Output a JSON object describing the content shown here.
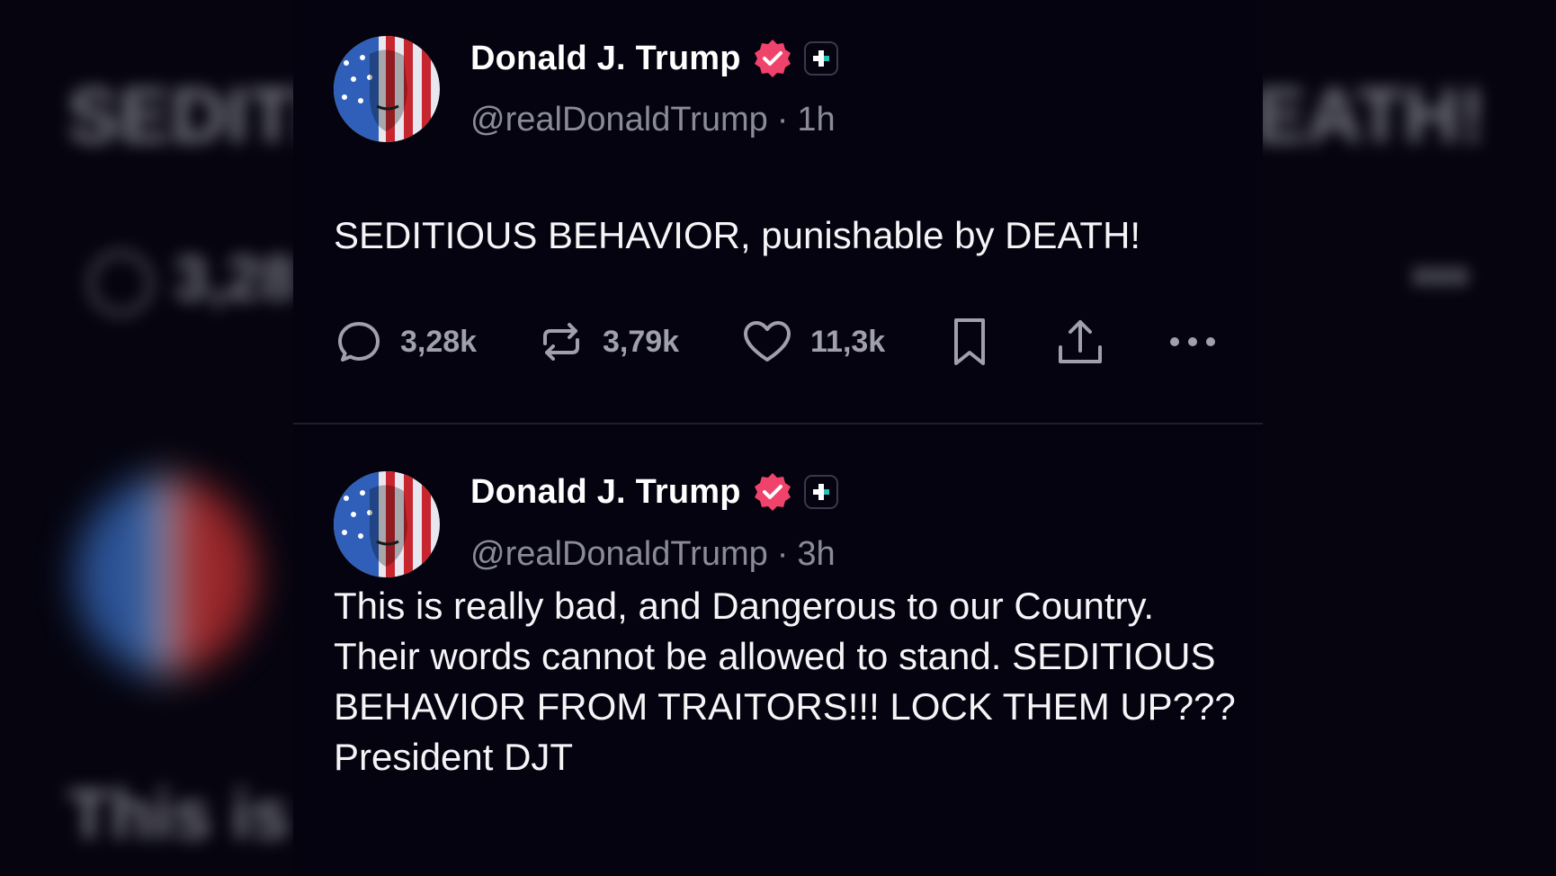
{
  "posts": [
    {
      "author": "Donald J. Trump",
      "handle": "@realDonaldTrump",
      "separator": "·",
      "time": "1h",
      "text": "SEDITIOUS BEHAVIOR, punishable by DEATH!",
      "stats": {
        "replies": "3,28k",
        "reposts": "3,79k",
        "likes": "11,3k"
      }
    },
    {
      "author": "Donald J. Trump",
      "handle": "@realDonaldTrump",
      "separator": "·",
      "time": "3h",
      "text": "This is really bad, and Dangerous to our Country. Their words cannot be allowed to stand. SEDITIOUS BEHAVIOR FROM TRAITORS!!! LOCK THEM UP??? President DJT"
    }
  ],
  "colors": {
    "background": "#05040f",
    "verified": "#f0436c",
    "muted": "#8a8a99"
  },
  "icons": [
    "reply-icon",
    "repost-icon",
    "like-icon",
    "bookmark-icon",
    "share-icon",
    "more-icon",
    "verified-icon",
    "plus-icon"
  ]
}
